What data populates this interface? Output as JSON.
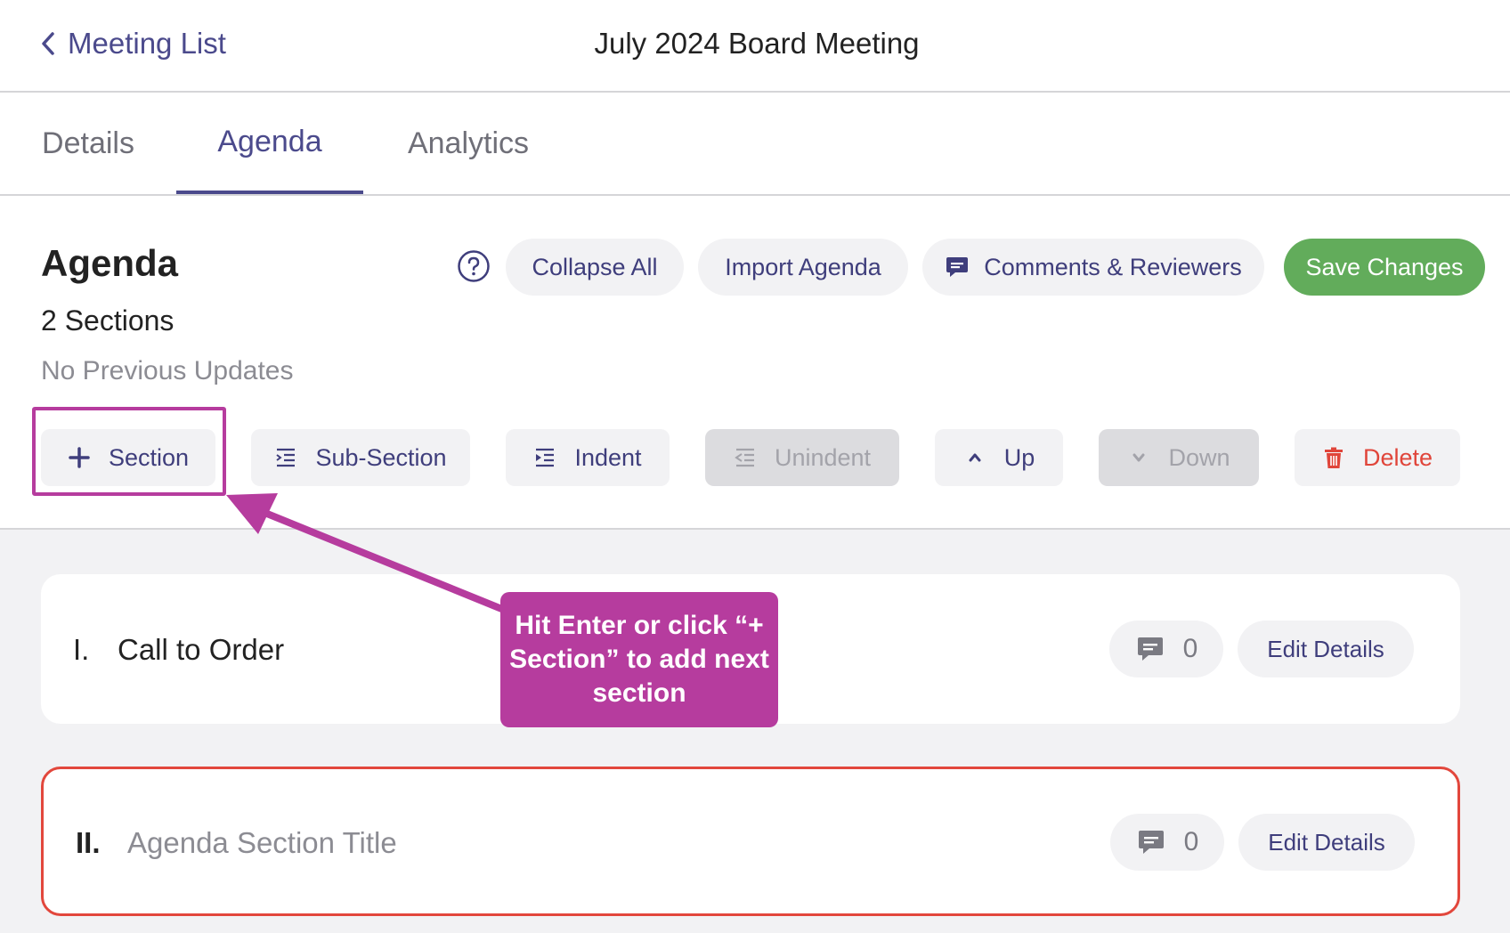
{
  "header": {
    "back_label": "Meeting List",
    "title": "July 2024 Board Meeting"
  },
  "tabs": [
    {
      "label": "Details",
      "active": false
    },
    {
      "label": "Agenda",
      "active": true
    },
    {
      "label": "Analytics",
      "active": false
    }
  ],
  "agenda": {
    "title": "Agenda",
    "section_count": "2 Sections",
    "updates": "No Previous Updates",
    "actions": {
      "collapse_all": "Collapse All",
      "import_agenda": "Import Agenda",
      "comments_reviewers": "Comments & Reviewers",
      "save_changes": "Save Changes"
    },
    "toolbar": {
      "section": "Section",
      "sub_section": "Sub-Section",
      "indent": "Indent",
      "unindent": "Unindent",
      "up": "Up",
      "down": "Down",
      "delete": "Delete"
    }
  },
  "sections": [
    {
      "number": "I.",
      "title": "Call to Order",
      "comments": "0",
      "edit_label": "Edit Details"
    },
    {
      "number": "II.",
      "placeholder": "Agenda Section Title",
      "comments": "0",
      "edit_label": "Edit Details"
    }
  ],
  "callout": {
    "text": "Hit Enter or click “+ Section” to add next section"
  },
  "colors": {
    "accent": "#4b4a8c",
    "save": "#62ac5b",
    "danger": "#e0453a",
    "callout": "#b63c9e"
  }
}
